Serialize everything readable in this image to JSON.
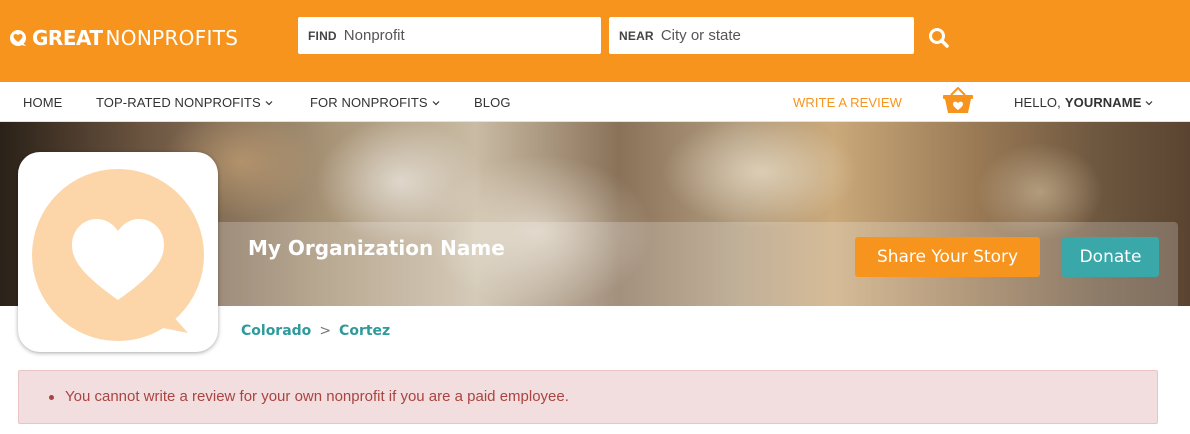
{
  "header": {
    "logo_great": "GREAT",
    "logo_nonprofits": "NONPROFITS",
    "find_label": "FIND",
    "find_placeholder": "Nonprofit",
    "near_label": "NEAR",
    "near_placeholder": "City or state",
    "search_icon": "search-icon",
    "brand_color": "#f7941e"
  },
  "nav": {
    "home": "HOME",
    "top_rated": "TOP-RATED NONPROFITS",
    "for_nonprofits": "FOR NONPROFITS",
    "blog": "BLOG",
    "write_review": "WRITE A REVIEW",
    "basket_icon": "heart-basket-icon",
    "hello": "HELLO,",
    "username": "YOURNAME"
  },
  "profile": {
    "org_name": "My Organization Name",
    "share_button": "Share Your Story",
    "donate_button": "Donate",
    "share_color": "#f7941e",
    "donate_color": "#3aa7a9",
    "avatar_icon": "heart-chat-bubble-icon"
  },
  "breadcrumb": {
    "state": "Colorado",
    "separator": ">",
    "city": "Cortez"
  },
  "alert": {
    "message": "You cannot write a review for your own nonprofit if you are a paid employee.",
    "color": "#a94442"
  }
}
